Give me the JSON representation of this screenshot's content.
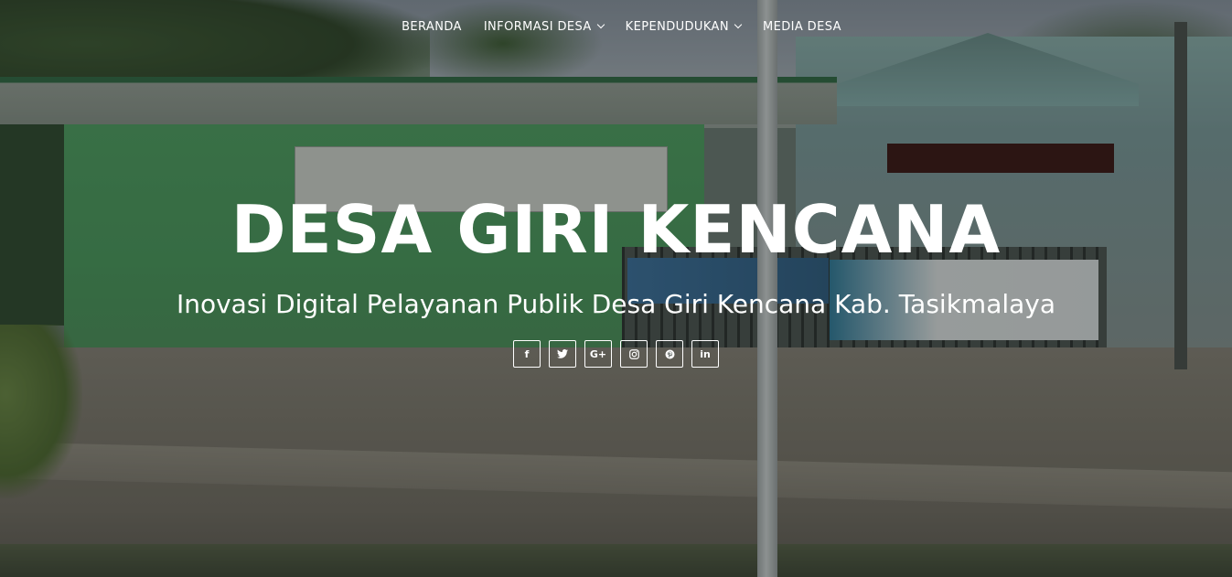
{
  "nav": {
    "items": [
      {
        "label": "BERANDA",
        "dropdown": false
      },
      {
        "label": "INFORMASI DESA",
        "dropdown": true
      },
      {
        "label": "KEPENDUDUKAN",
        "dropdown": true
      },
      {
        "label": "MEDIA DESA",
        "dropdown": false
      }
    ]
  },
  "hero": {
    "title": "DESA GIRI KENCANA",
    "subtitle": "Inovasi Digital Pelayanan Publik Desa Giri Kencana Kab. Tasikmalaya"
  },
  "socials": [
    {
      "icon": "facebook-icon",
      "glyph": "f"
    },
    {
      "icon": "twitter-icon",
      "glyph": "t"
    },
    {
      "icon": "google-plus-icon",
      "glyph": "G+"
    },
    {
      "icon": "instagram-icon",
      "glyph": ""
    },
    {
      "icon": "pinterest-icon",
      "glyph": ""
    },
    {
      "icon": "linkedin-icon",
      "glyph": "in"
    }
  ],
  "colors": {
    "text": "#ffffff",
    "overlay": "rgba(20,26,24,0.38)"
  }
}
